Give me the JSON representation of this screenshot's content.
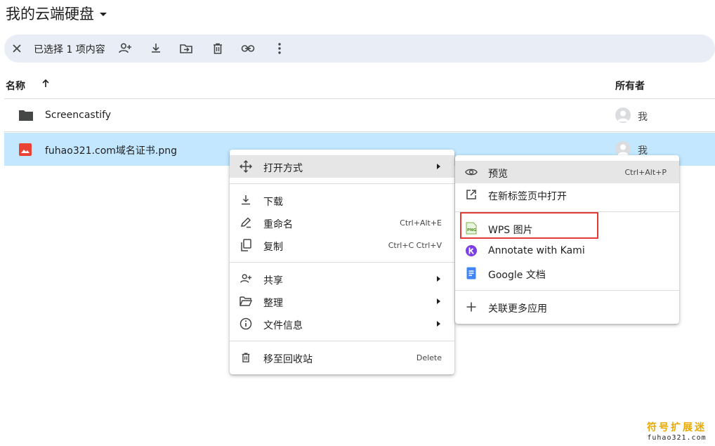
{
  "header": {
    "title": "我的云端硬盘"
  },
  "selection_bar": {
    "count_label": "已选择 1 项内容",
    "actions": [
      "close-icon",
      "add-person-icon",
      "download-icon",
      "move-to-folder-icon",
      "trash-icon",
      "link-icon",
      "more-vert-icon"
    ]
  },
  "columns": {
    "name": "名称",
    "owner": "所有者"
  },
  "files": [
    {
      "name": "Screencastify",
      "type": "folder",
      "owner": "我"
    },
    {
      "name": "fuhao321.com域名证书.png",
      "type": "image",
      "owner": "我",
      "selected": true
    }
  ],
  "context_menu": {
    "items": [
      {
        "label": "打开方式",
        "icon": "move-arrows-icon",
        "submenu": true
      },
      {
        "label": "下载",
        "icon": "download-icon"
      },
      {
        "label": "重命名",
        "icon": "edit-icon",
        "shortcut": "Ctrl+Alt+E"
      },
      {
        "label": "复制",
        "icon": "copy-icon",
        "shortcut": "Ctrl+C Ctrl+V"
      },
      {
        "label": "共享",
        "icon": "add-person-icon",
        "submenu": true
      },
      {
        "label": "整理",
        "icon": "folder-open-icon",
        "submenu": true
      },
      {
        "label": "文件信息",
        "icon": "info-icon",
        "submenu": true
      },
      {
        "label": "移至回收站",
        "icon": "trash-icon",
        "shortcut": "Delete"
      }
    ]
  },
  "open_with_menu": {
    "items": [
      {
        "label": "预览",
        "icon": "eye-icon",
        "shortcut": "Ctrl+Alt+P"
      },
      {
        "label": "在新标签页中打开",
        "icon": "open-in-new-icon"
      },
      {
        "label": "WPS 图片",
        "icon": "wps-png-icon"
      },
      {
        "label": "Annotate with Kami",
        "icon": "kami-icon"
      },
      {
        "label": "Google 文档",
        "icon": "google-docs-icon"
      },
      {
        "label": "关联更多应用",
        "icon": "plus-icon"
      }
    ]
  },
  "watermark": {
    "line1": "符号扩展迷",
    "line2": "fuhao321.com"
  },
  "colors": {
    "selected_row": "#c2e7ff",
    "selection_bar": "#e9eef6",
    "highlight": "#e6e6e6",
    "annotation_box": "#e53935"
  }
}
